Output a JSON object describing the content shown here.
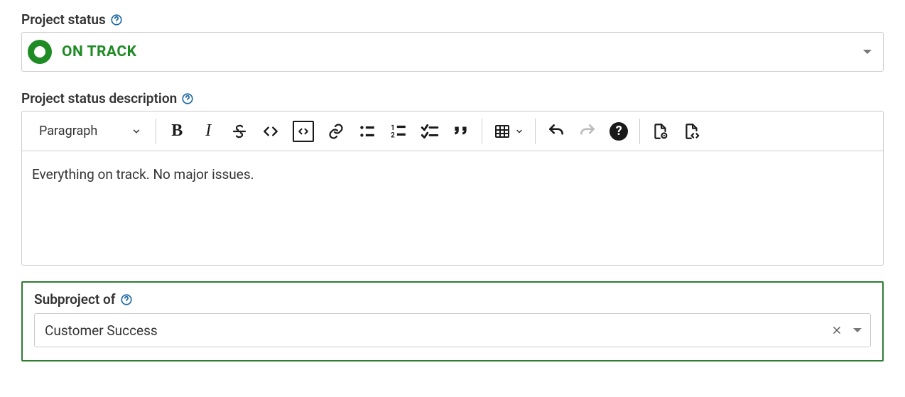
{
  "labels": {
    "project_status": "Project status",
    "project_status_description": "Project status description",
    "subproject_of": "Subproject of"
  },
  "status": {
    "value": "ON TRACK",
    "color": "#1f8b24"
  },
  "editor": {
    "format_label": "Paragraph",
    "content": "Everything on track. No major issues."
  },
  "subproject": {
    "value": "Customer Success"
  }
}
